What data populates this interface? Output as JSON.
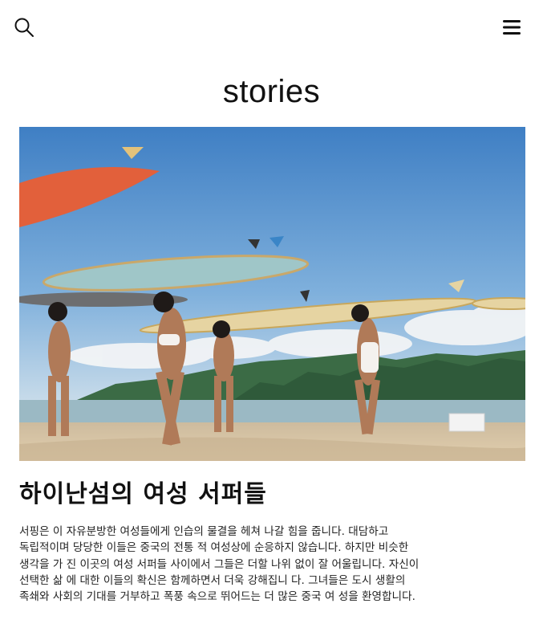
{
  "header": {
    "search_icon": "search-icon",
    "menu_icon": "hamburger-menu-icon"
  },
  "page": {
    "title": "stories"
  },
  "story": {
    "image_subject": "surfers-walking-on-beach",
    "title": "하이난섬의 여성 서퍼들",
    "excerpt": "서핑은 이 자유분방한 여성들에게 인습의 물결을 헤쳐 나갈 힘을 줍니다. 대담하고 독립적이며 당당한 이들은 중국의 전통 적 여성상에 순응하지 않습니다. 하지만 비슷한 생각을 가 진 이곳의 여성 서퍼들 사이에서 그들은 더할 나위 없이 잘 어울립니다. 자신이 선택한 삶 에 대한 이들의 확신은 함께하면서 더욱 강해집니 다. 그녀들은 도시 생활의 족쇄와 사회의 기대를 거부하고 폭풍 속으로 뛰어드는 더 많은 중국 여 성을 환영합니다."
  },
  "colors": {
    "text": "#111111",
    "background": "#ffffff",
    "sky": "#4f86c6",
    "sand": "#d8c3a0"
  }
}
